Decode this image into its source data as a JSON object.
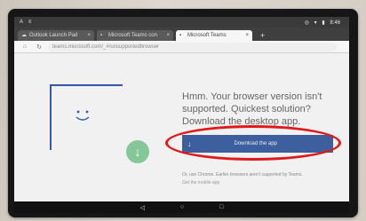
{
  "status_bar": {
    "left_icons": [
      "A",
      "≡"
    ],
    "time": "8:46",
    "right_icons": [
      "◎",
      "▾",
      "▮"
    ]
  },
  "tabs": [
    {
      "label": "Outlook Launch Pad",
      "icon": "cloud-icon"
    },
    {
      "label": "Microsoft Teams con",
      "icon": "ms-icon"
    },
    {
      "label": "Microsoft Teams",
      "icon": "ms-icon"
    }
  ],
  "toolbar": {
    "home": "⌂",
    "reload": "↻",
    "url": "teams.microsoft.com/_#/unsupportedbrowser"
  },
  "content": {
    "headline_lines": [
      "Hmm. Your browser version isn't",
      "supported. Quickest solution?",
      "Download the desktop app."
    ],
    "download_label": "Download the app",
    "note": "Or, use Chrome. Earlier browsers aren't supported by Teams.",
    "note_sub": "Get the mobile app"
  },
  "nav": {
    "back": "◁",
    "home": "○",
    "recents": "□"
  },
  "colors": {
    "button": "#3d5f9e",
    "highlight": "#e01a1a",
    "illustration_line": "#3259b0",
    "download_circle": "#86c79a"
  }
}
